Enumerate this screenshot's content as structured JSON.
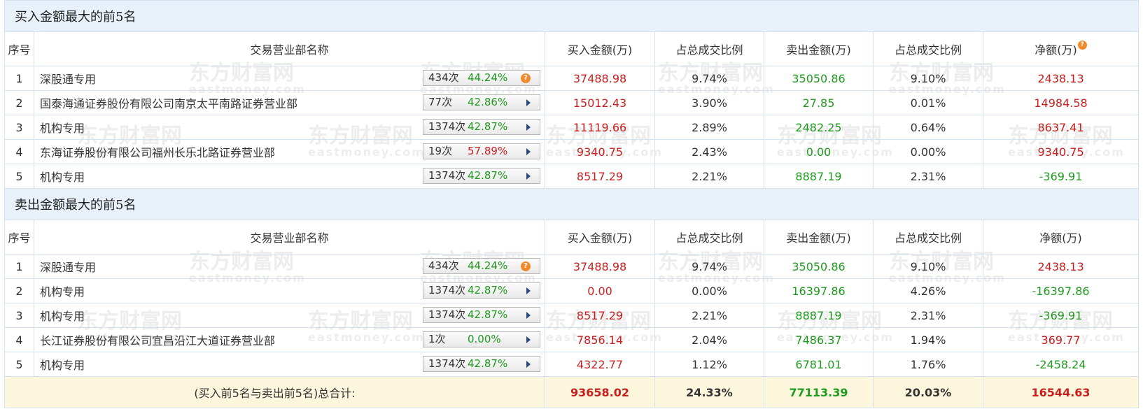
{
  "buy_section": {
    "title": "买入金额最大的前5名",
    "rows": [
      {
        "rank": "1",
        "name": "深股通专用",
        "count": "434次",
        "rate": "44.24%",
        "rate_color": "green",
        "icon": "question-icon",
        "buy": "37488.98",
        "buy_pct": "9.74%",
        "sell": "35050.86",
        "sell_pct": "9.10%",
        "net": "2438.13",
        "net_color": "red"
      },
      {
        "rank": "2",
        "name": "国泰海通证券股份有限公司南京太平南路证券营业部",
        "count": "77次",
        "rate": "42.86%",
        "rate_color": "green",
        "icon": "play-arrow-icon",
        "buy": "15012.43",
        "buy_pct": "3.90%",
        "sell": "27.85",
        "sell_pct": "0.01%",
        "net": "14984.58",
        "net_color": "red"
      },
      {
        "rank": "3",
        "name": "机构专用",
        "count": "1374次",
        "rate": "42.87%",
        "rate_color": "green",
        "icon": "play-arrow-icon",
        "buy": "11119.66",
        "buy_pct": "2.89%",
        "sell": "2482.25",
        "sell_pct": "0.64%",
        "net": "8637.41",
        "net_color": "red"
      },
      {
        "rank": "4",
        "name": "东海证券股份有限公司福州长乐北路证券营业部",
        "count": "19次",
        "rate": "57.89%",
        "rate_color": "red",
        "icon": "play-arrow-icon",
        "buy": "9340.75",
        "buy_pct": "2.43%",
        "sell": "0.00",
        "sell_pct": "0.00%",
        "net": "9340.75",
        "net_color": "red"
      },
      {
        "rank": "5",
        "name": "机构专用",
        "count": "1374次",
        "rate": "42.87%",
        "rate_color": "green",
        "icon": "play-arrow-icon",
        "buy": "8517.29",
        "buy_pct": "2.21%",
        "sell": "8887.19",
        "sell_pct": "2.31%",
        "net": "-369.91",
        "net_color": "green"
      }
    ]
  },
  "sell_section": {
    "title": "卖出金额最大的前5名",
    "rows": [
      {
        "rank": "1",
        "name": "深股通专用",
        "count": "434次",
        "rate": "44.24%",
        "rate_color": "green",
        "icon": "question-icon",
        "buy": "37488.98",
        "buy_pct": "9.74%",
        "sell": "35050.86",
        "sell_pct": "9.10%",
        "net": "2438.13",
        "net_color": "red"
      },
      {
        "rank": "2",
        "name": "机构专用",
        "count": "1374次",
        "rate": "42.87%",
        "rate_color": "green",
        "icon": "play-arrow-icon",
        "buy": "0.00",
        "buy_pct": "0.00%",
        "sell": "16397.86",
        "sell_pct": "4.26%",
        "net": "-16397.86",
        "net_color": "green"
      },
      {
        "rank": "3",
        "name": "机构专用",
        "count": "1374次",
        "rate": "42.87%",
        "rate_color": "green",
        "icon": "play-arrow-icon",
        "buy": "8517.29",
        "buy_pct": "2.21%",
        "sell": "8887.19",
        "sell_pct": "2.31%",
        "net": "-369.91",
        "net_color": "green"
      },
      {
        "rank": "4",
        "name": "长江证券股份有限公司宜昌沿江大道证券营业部",
        "count": "1次",
        "rate": "0.00%",
        "rate_color": "green",
        "icon": "play-arrow-icon",
        "buy": "7856.14",
        "buy_pct": "2.04%",
        "sell": "7486.37",
        "sell_pct": "1.94%",
        "net": "369.77",
        "net_color": "red"
      },
      {
        "rank": "5",
        "name": "机构专用",
        "count": "1374次",
        "rate": "42.87%",
        "rate_color": "green",
        "icon": "play-arrow-icon",
        "buy": "4322.77",
        "buy_pct": "1.12%",
        "sell": "6781.01",
        "sell_pct": "1.76%",
        "net": "-2458.24",
        "net_color": "green"
      }
    ]
  },
  "headers": {
    "rank": "序号",
    "name": "交易营业部名称",
    "buy": "买入金额(万)",
    "buy_pct": "占总成交比例",
    "sell": "卖出金额(万)",
    "sell_pct": "占总成交比例",
    "net": "净额(万)",
    "net_help": "?"
  },
  "icon_glyph": "?",
  "total": {
    "label": "(买入前5名与卖出前5名)总合计:",
    "buy": "93658.02",
    "buy_pct": "24.33%",
    "sell": "77113.39",
    "sell_pct": "20.03%",
    "net": "16544.63"
  },
  "watermark": {
    "brand": "东方财富网",
    "domain": "eastmoney.com"
  },
  "colors": {
    "red": "#c81e1e",
    "green": "#1e9a1e",
    "header_bg": "#e8f1f9",
    "total_bg": "#fbf6dc",
    "border": "#d3e2ee",
    "badge": "#f08a2c"
  }
}
